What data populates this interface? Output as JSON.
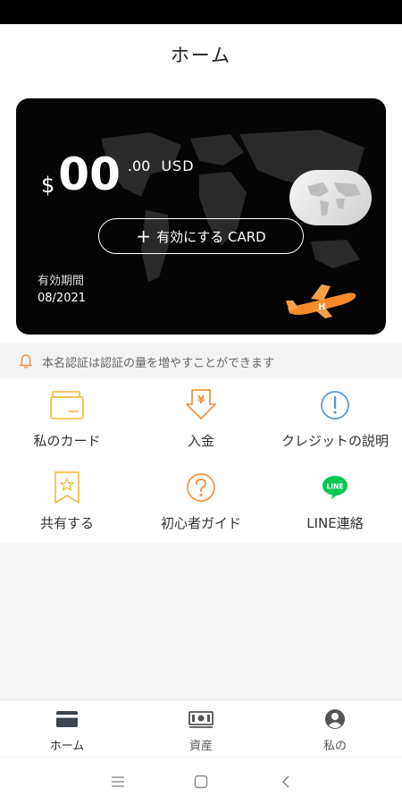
{
  "header": {
    "title": "ホーム"
  },
  "card": {
    "currency_sign": "$",
    "balance_integer": "00",
    "balance_decimal": ".00",
    "currency": "USD",
    "activate_label": "有効にする CARD",
    "expiry_label": "有効期間",
    "expiry_value": "08/2021"
  },
  "notice": {
    "text": "本名認証は認証の量を増やすことができます",
    "icon": "bell-icon"
  },
  "menu": [
    {
      "label": "私のカード",
      "icon": "card-icon"
    },
    {
      "label": "入金",
      "icon": "yen-deposit-icon"
    },
    {
      "label": "クレジットの説明",
      "icon": "info-icon"
    },
    {
      "label": "共有する",
      "icon": "star-bookmark-icon"
    },
    {
      "label": "初心者ガイド",
      "icon": "question-icon"
    },
    {
      "label": "LINE連絡",
      "icon": "line-icon"
    }
  ],
  "tabs": [
    {
      "label": "ホーム",
      "icon": "card-icon"
    },
    {
      "label": "資産",
      "icon": "money-icon"
    },
    {
      "label": "私の",
      "icon": "user-icon"
    }
  ],
  "colors": {
    "accent_orange": "#f0964a",
    "yellow": "#f2c04d",
    "blue": "#5b9bd5",
    "line_green": "#06c755"
  }
}
